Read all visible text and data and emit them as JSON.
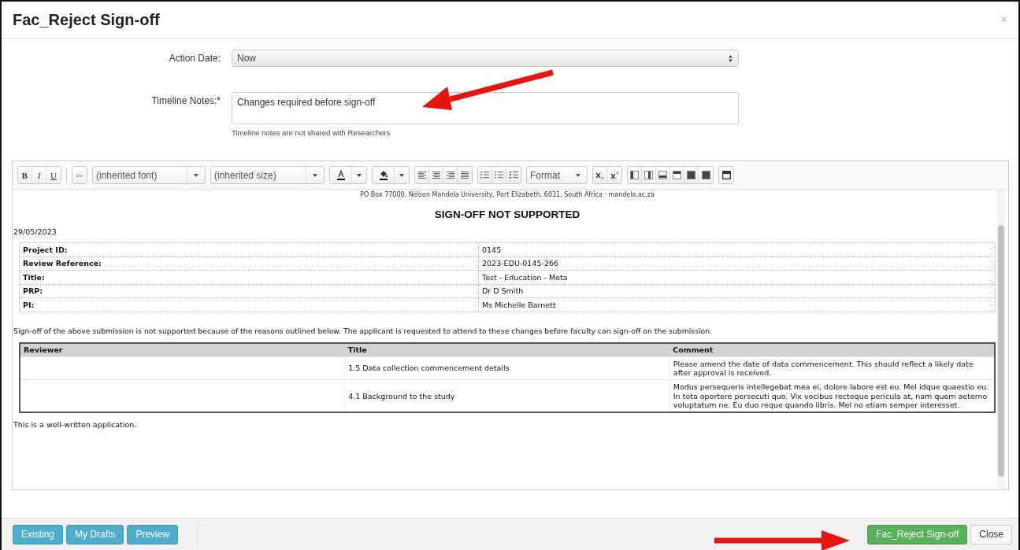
{
  "dialog": {
    "title": "Fac_Reject Sign-off",
    "close": "×"
  },
  "form": {
    "action_date": {
      "label": "Action Date:",
      "value": "Now"
    },
    "timeline_notes": {
      "label": "Timeline Notes:*",
      "value": "Changes required before sign-off",
      "help": "Timeline notes are not shared with Researchers"
    }
  },
  "toolbar": {
    "style_buttons": [
      "B",
      "I",
      "U"
    ],
    "strike": "abc",
    "font": "(inherited font)",
    "size": "(inherited size)",
    "format": "Format"
  },
  "document": {
    "address": "PO Box 77000, Nelson Mandela University, Port Elizabeth, 6031, South Africa · mandela.ac.za",
    "heading": "SIGN-OFF NOT SUPPORTED",
    "date": "29/05/2023",
    "details": [
      {
        "label": "Project ID:",
        "value": "0145"
      },
      {
        "label": "Review Reference:",
        "value": "2023-EDU-0145-266"
      },
      {
        "label": "Title:",
        "value": "Test - Education - Meta"
      },
      {
        "label": "PRP:",
        "value": "Dr D Smith"
      },
      {
        "label": "PI:",
        "value": "Ms Michelle Barnett"
      }
    ],
    "intro": "Sign-off of the above submission is not supported because of the reasons outlined below. The applicant is requested to attend to these changes before faculty can sign-off on the submission.",
    "review_table": {
      "columns": [
        "Reviewer",
        "Title",
        "Comment"
      ],
      "rows": [
        {
          "title": "1.5 Data collection commencement details",
          "comment": "Please amend the date of data commencement. This should reflect a likely date after approval is received."
        },
        {
          "title": "4.1 Background to the study",
          "comment": "Modus persequeris intellegebat mea ei, dolore labore est eu. Mel idque quaestio eu. In tota oportere persecuti quo. Vix vocibus recteque pericula at, nam quem aeterno voluptatum ne. Eu duo reque quando libris. Mel no etiam semper interesset."
        }
      ]
    },
    "closing": "This is a well-written application."
  },
  "footer": {
    "left_buttons": [
      "Existing",
      "My Drafts",
      "Preview"
    ],
    "primary": "Fac_Reject Sign-off",
    "close": "Close"
  }
}
